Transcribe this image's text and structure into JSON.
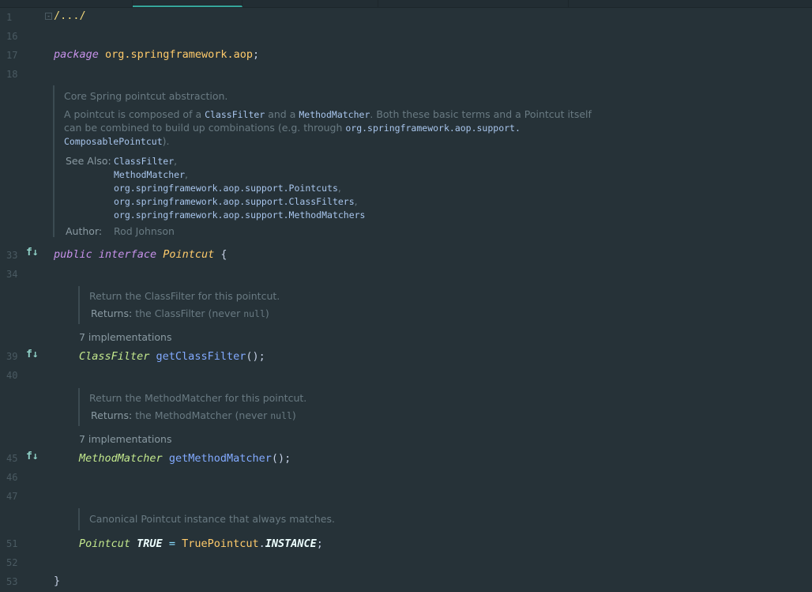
{
  "line_numbers": [
    "1",
    "16",
    "17",
    "18",
    "33",
    "34",
    "39",
    "40",
    "45",
    "46",
    "47",
    "51",
    "52",
    "53"
  ],
  "fold": {
    "text": "/.../",
    "toggle": "-"
  },
  "package_line": {
    "keyword": "package",
    "name": "org.springframework.aop",
    "semicolon": ";"
  },
  "class_doc": {
    "summary": "Core Spring pointcut abstraction.",
    "p1_a": "A pointcut is composed of a ",
    "p1_code1": "ClassFilter",
    "p1_b": " and a ",
    "p1_code2": "MethodMatcher",
    "p1_c": ". Both these basic terms and a Pointcut itself",
    "p2_a": "can be combined to build up combinations (e.g. through ",
    "p2_code": "org.springframework.aop.support.",
    "p3_code": "ComposablePointcut",
    "p3_b": ").",
    "see_also_label": "See Also:",
    "see_also": [
      "ClassFilter",
      "MethodMatcher",
      "org.springframework.aop.support.Pointcuts",
      "org.springframework.aop.support.ClassFilters",
      "org.springframework.aop.support.MethodMatchers"
    ],
    "comma": ",",
    "author_label": "Author:",
    "author": "Rod Johnson"
  },
  "interface_line": {
    "public": "public",
    "interface": "interface",
    "name": "Pointcut",
    "brace": "{"
  },
  "method1": {
    "doc": "Return the ClassFilter for this pointcut.",
    "returns_label": "Returns:",
    "returns_text": "the ClassFilter (never ",
    "null": "null",
    "close": ")",
    "implementations": "7 implementations",
    "type": "ClassFilter",
    "name": "getClassFilter",
    "parens": "();"
  },
  "method2": {
    "doc": "Return the MethodMatcher for this pointcut.",
    "returns_label": "Returns:",
    "returns_text": "the MethodMatcher (never ",
    "null": "null",
    "close": ")",
    "implementations": "7 implementations",
    "type": "MethodMatcher",
    "name": "getMethodMatcher",
    "parens": "();"
  },
  "field": {
    "doc": "Canonical Pointcut instance that always matches.",
    "type": "Pointcut",
    "name": "TRUE",
    "eq": " = ",
    "impl": "TruePointcut",
    "dot": ".",
    "member": "INSTANCE",
    "semi": ";"
  },
  "closing_brace": "}",
  "gutter_icons": [
    "implemented-icon",
    "implemented-icon",
    "implemented-icon"
  ]
}
